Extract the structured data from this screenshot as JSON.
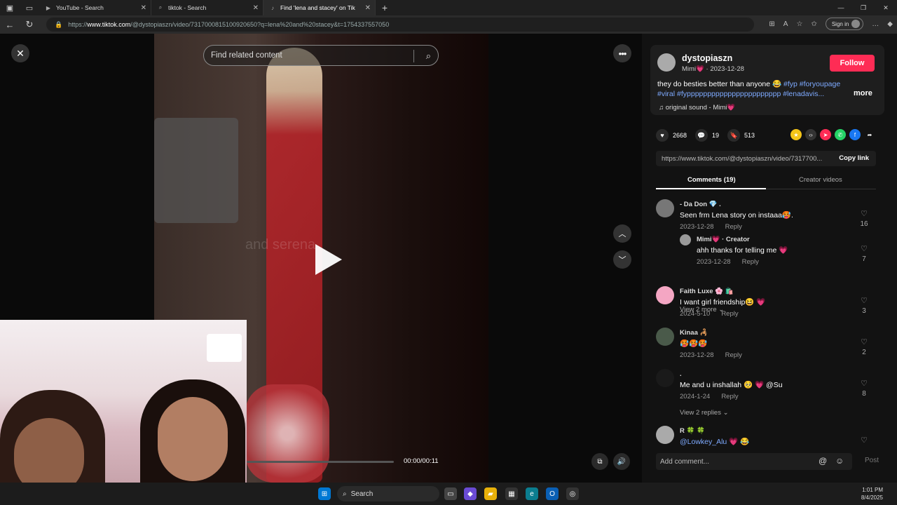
{
  "browser": {
    "tabs": [
      {
        "title": "YouTube - Search",
        "icon": "youtube-icon"
      },
      {
        "title": "tiktok - Search",
        "icon": "search-icon"
      },
      {
        "title": "Find 'lena and stacey' on Tik",
        "icon": "tiktok-icon"
      }
    ],
    "url_prefix": "https://",
    "url_domain": "www.tiktok.com",
    "url_path": "/@dystopiaszn/video/7317000815100920650?q=lena%20and%20stacey&t=1754337557050",
    "signin_label": "Sign in"
  },
  "player": {
    "search_placeholder": "Find related content",
    "watermark": "and serena",
    "time": "00:00/00:11",
    "progress_fraction": 0.0
  },
  "post": {
    "username": "dystopiaszn",
    "subline": "Mimi💗 · 2023-12-28",
    "follow_label": "Follow",
    "caption_text": "they do besties better than anyone 😂 ",
    "caption_tags": "#fyp #foryoupage #viral #fyppppppppppppppppppppppp #lenadavis...",
    "more_label": "more",
    "sound": "♫  original sound - Mimi💗",
    "likes": "2668",
    "comments_count": "19",
    "saves": "513",
    "share_link": "https://www.tiktok.com/@dystopiaszn/video/7317700...",
    "copy_label": "Copy link",
    "tab_comments": "Comments (19)",
    "tab_creator": "Creator videos"
  },
  "comments": [
    {
      "name": "- Da Don 💎 .",
      "text": "Seen frm Lena story on instaaa🥵.",
      "date": "2023-12-28",
      "reply": "Reply",
      "likes": "16",
      "color": "#777"
    },
    {
      "name": "Mimi💗 · Creator",
      "text": "ahh thanks for telling me 💗",
      "date": "2023-12-28",
      "reply": "Reply",
      "likes": "7",
      "color": "#999"
    },
    {
      "name": "Faith Luxe 🌸 🛍️",
      "text": "I want girl friendship😆 💗",
      "date": "2024-5-10",
      "reply": "Reply",
      "likes": "3",
      "color": "#f4a6c3"
    },
    {
      "name": "Kinaa 🦂",
      "text": "🥵🥵🥵",
      "date": "2023-12-28",
      "reply": "Reply",
      "likes": "2",
      "color": "#4a5a4a"
    },
    {
      "name": ".",
      "text": "Me and u inshallah 🥺 💗 @Su",
      "date": "2024-1-24",
      "reply": "Reply",
      "likes": "8",
      "color": "#1a1a1a"
    },
    {
      "name": "R 🍀 🍀",
      "text": "@Lowkey_Alu 💗 😂",
      "date": "",
      "reply": "",
      "likes": "",
      "color": "#aaa"
    }
  ],
  "view_more_1": "View 2 more ⌄",
  "view_more_2": "View 2 replies ⌄",
  "add_comment_placeholder": "Add comment...",
  "post_label": "Post",
  "taskbar": {
    "search_label": "Search",
    "time": "1:01 PM",
    "date": "8/4/2025"
  }
}
